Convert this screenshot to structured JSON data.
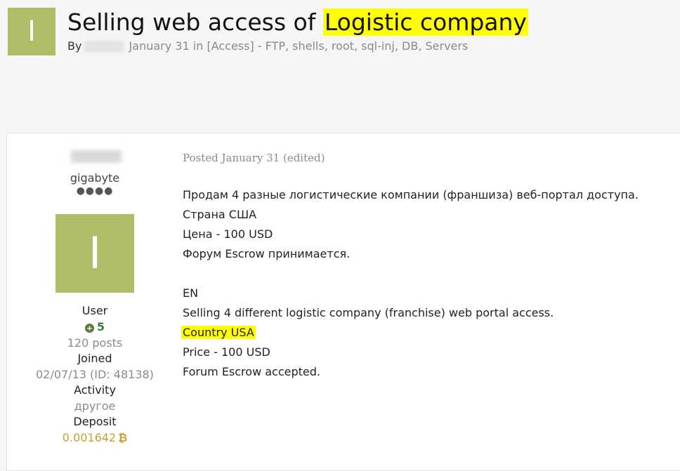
{
  "header": {
    "avatar_letter": "I",
    "title_prefix": "Selling web access of ",
    "title_highlight": "Logistic company",
    "by_label": "By",
    "date": "January 31",
    "in_label": "in",
    "forum_link": "[Access] - FTP, shells, root, sql-inj, DB, Servers"
  },
  "author": {
    "title": "gigabyte",
    "rank_dots": "●●●●",
    "avatar_letter": "I",
    "group": "User",
    "reputation": "5",
    "posts": "120 posts",
    "joined_label": "Joined",
    "joined_value": "02/07/13 (ID: 48138)",
    "activity_label": "Activity",
    "activity_value": "другое",
    "deposit_label": "Deposit",
    "deposit_value": "0.001642",
    "deposit_currency_symbol": "₿"
  },
  "post": {
    "posted": "Posted January 31 (edited)",
    "lines": [
      "Продам 4 разные логистические компании (франшиза) веб-портал доступа.",
      "Страна США",
      "Цена - 100 USD",
      "Форум Escrow принимается.",
      "",
      "EN",
      "Selling 4 different logistic company (franchise) web portal access.",
      "Country USA",
      "Price - 100 USD",
      "Forum Escrow accepted."
    ]
  },
  "colors": {
    "avatar_bg": "#aebd67",
    "highlight": "#ffff00",
    "deposit": "#c8a032",
    "reputation": "#3c7a3c"
  }
}
